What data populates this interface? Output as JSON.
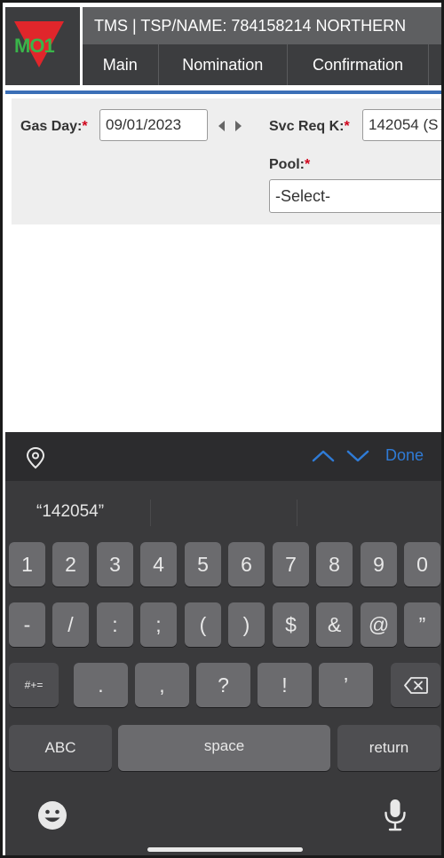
{
  "header": {
    "logo_text": "MO1",
    "title": "TMS | TSP/NAME: 784158214 NORTHERN",
    "nav": [
      "Main",
      "Nomination",
      "Confirmation"
    ]
  },
  "form": {
    "gas_day_label": "Gas Day:",
    "gas_day_value": "09/01/2023",
    "svc_req_label": "Svc Req K:",
    "svc_req_value": "142054 (S",
    "pool_label": "Pool:",
    "pool_value": "-Select-",
    "required_mark": "*"
  },
  "keyboard": {
    "suggestion": "“142054”",
    "done_label": "Done",
    "row1": [
      "1",
      "2",
      "3",
      "4",
      "5",
      "6",
      "7",
      "8",
      "9",
      "0"
    ],
    "row2": [
      "-",
      "/",
      ":",
      ";",
      "(",
      ")",
      "$",
      "&",
      "@",
      "”"
    ],
    "row3": [
      ".",
      ",",
      "?",
      "!",
      "’"
    ],
    "symbols_label": "#+=",
    "abc_label": "ABC",
    "space_label": "space",
    "return_label": "return"
  },
  "colors": {
    "accent_blue": "#3b6fb6",
    "required_red": "#d0021b",
    "done_blue": "#2f7bd6"
  }
}
